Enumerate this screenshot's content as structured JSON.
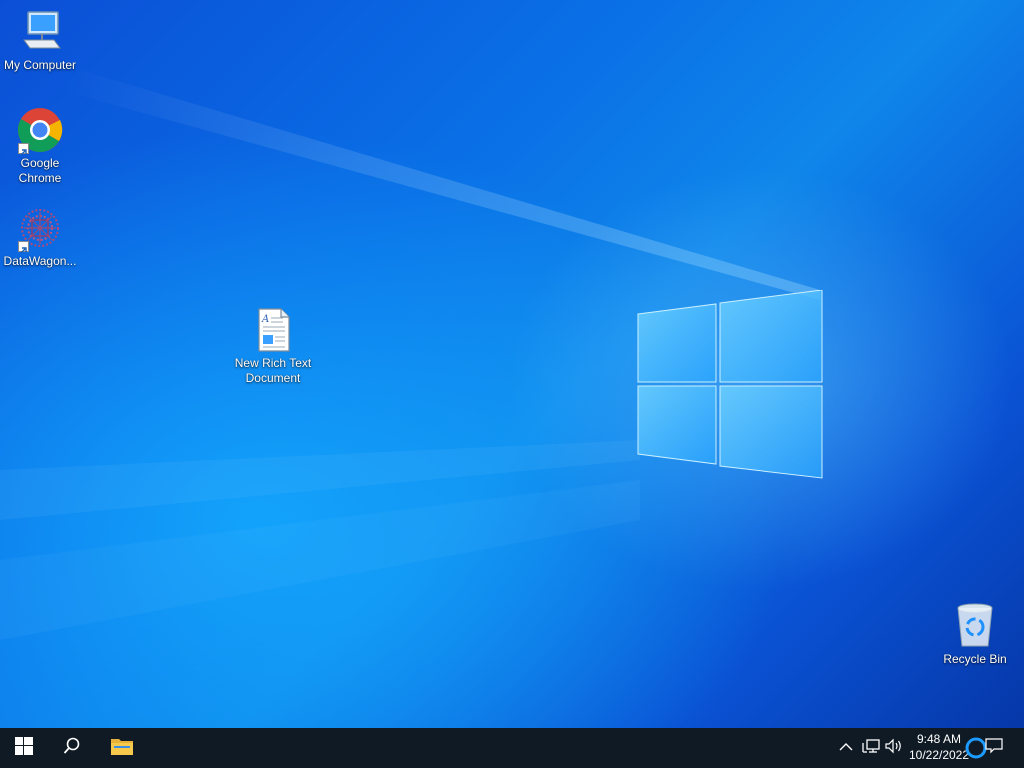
{
  "desktop": {
    "icons": [
      {
        "name": "my-computer",
        "label": "My Computer",
        "icon": "monitor-icon"
      },
      {
        "name": "google-chrome",
        "label": "Google\nChrome",
        "icon": "chrome-icon",
        "shortcut": true
      },
      {
        "name": "datawagon",
        "label": "DataWagon...",
        "icon": "datawagon-icon",
        "shortcut": true
      },
      {
        "name": "new-rich-text-document",
        "label": "New Rich Text\nDocument",
        "icon": "rtf-document-icon"
      },
      {
        "name": "recycle-bin",
        "label": "Recycle Bin",
        "icon": "recycle-bin-icon"
      }
    ]
  },
  "taskbar": {
    "start_icon": "windows-logo-icon",
    "search_icon": "search-icon",
    "explorer_icon": "folder-icon",
    "tray_icons": [
      "chevron-up-icon",
      "network-icon",
      "volume-icon"
    ],
    "clock": {
      "time": "9:48 AM",
      "date": "10/22/2022"
    },
    "notification_icon": "notification-icon"
  },
  "colors": {
    "taskbar_bg": "#0f1a24",
    "wallpaper_accent": "#0a6fe6"
  }
}
